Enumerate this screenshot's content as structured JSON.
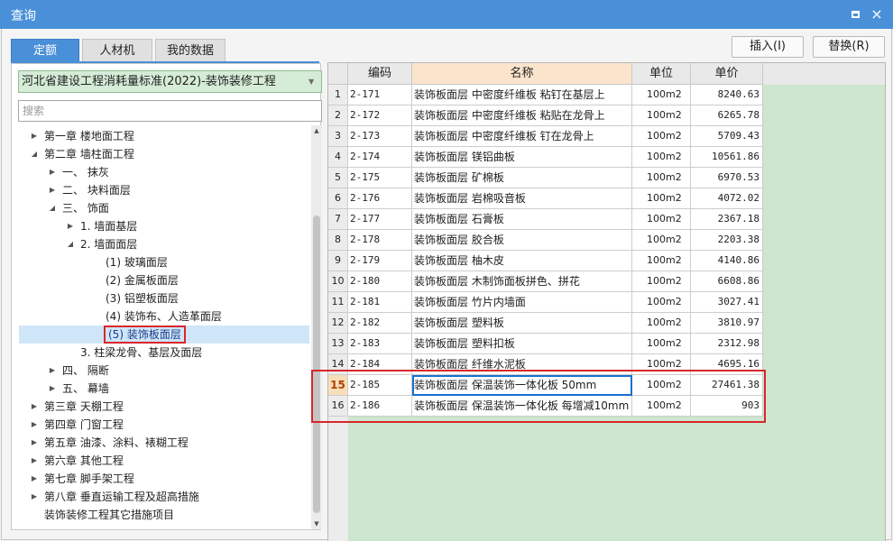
{
  "window": {
    "title": "查询",
    "maximize_icon": "maximize-icon",
    "close_icon": "close-icon",
    "close_glyph": "×"
  },
  "tabs": [
    {
      "label": "定额",
      "active": true
    },
    {
      "label": "人材机",
      "active": false
    },
    {
      "label": "我的数据",
      "active": false
    }
  ],
  "buttons": {
    "insert": "插入(I)",
    "replace": "替换(R)"
  },
  "standard_select": {
    "value": "河北省建设工程消耗量标准(2022)-装饰装修工程"
  },
  "search": {
    "placeholder": "搜索"
  },
  "tree": [
    {
      "label": "第一章 楼地面工程",
      "expanded": false,
      "has_children": true,
      "level": 0
    },
    {
      "label": "第二章 墙柱面工程",
      "expanded": true,
      "has_children": true,
      "level": 0
    },
    {
      "label": "一、 抹灰",
      "expanded": false,
      "has_children": true,
      "level": 1
    },
    {
      "label": "二、 块料面层",
      "expanded": false,
      "has_children": true,
      "level": 1
    },
    {
      "label": "三、 饰面",
      "expanded": true,
      "has_children": true,
      "level": 1
    },
    {
      "label": "1. 墙面基层",
      "expanded": false,
      "has_children": true,
      "level": 2
    },
    {
      "label": "2. 墙面面层",
      "expanded": true,
      "has_children": true,
      "level": 2
    },
    {
      "label": "(1) 玻璃面层",
      "has_children": false,
      "level": 3
    },
    {
      "label": "(2) 金属板面层",
      "has_children": false,
      "level": 3
    },
    {
      "label": "(3) 铝塑板面层",
      "has_children": false,
      "level": 3
    },
    {
      "label": "(4) 装饰布、人造革面层",
      "has_children": false,
      "level": 3
    },
    {
      "label": "(5) 装饰板面层",
      "has_children": false,
      "level": 3,
      "selected": true
    },
    {
      "label": "3. 柱梁龙骨、基层及面层",
      "has_children": false,
      "level": 2
    },
    {
      "label": "四、 隔断",
      "expanded": false,
      "has_children": true,
      "level": 1
    },
    {
      "label": "五、 幕墙",
      "expanded": false,
      "has_children": true,
      "level": 1
    },
    {
      "label": "第三章 天棚工程",
      "expanded": false,
      "has_children": true,
      "level": 0
    },
    {
      "label": "第四章 门窗工程",
      "expanded": false,
      "has_children": true,
      "level": 0
    },
    {
      "label": "第五章 油漆、涂料、裱糊工程",
      "expanded": false,
      "has_children": true,
      "level": 0
    },
    {
      "label": "第六章 其他工程",
      "expanded": false,
      "has_children": true,
      "level": 0
    },
    {
      "label": "第七章 脚手架工程",
      "expanded": false,
      "has_children": true,
      "level": 0
    },
    {
      "label": "第八章 垂直运输工程及超高措施",
      "expanded": false,
      "has_children": true,
      "level": 0
    },
    {
      "label": "装饰装修工程其它措施项目",
      "has_children": false,
      "level": 0
    }
  ],
  "table": {
    "columns": [
      "编码",
      "名称",
      "单位",
      "单价"
    ],
    "current_row": 15,
    "rows": [
      {
        "no": "1",
        "code": "2-171",
        "name": "装饰板面层 中密度纤维板 粘钉在基层上",
        "unit": "100m2",
        "price": "8240.63"
      },
      {
        "no": "2",
        "code": "2-172",
        "name": "装饰板面层 中密度纤维板 粘贴在龙骨上",
        "unit": "100m2",
        "price": "6265.78"
      },
      {
        "no": "3",
        "code": "2-173",
        "name": "装饰板面层 中密度纤维板 钉在龙骨上",
        "unit": "100m2",
        "price": "5709.43"
      },
      {
        "no": "4",
        "code": "2-174",
        "name": "装饰板面层 镁铝曲板",
        "unit": "100m2",
        "price": "10561.86"
      },
      {
        "no": "5",
        "code": "2-175",
        "name": "装饰板面层 矿棉板",
        "unit": "100m2",
        "price": "6970.53"
      },
      {
        "no": "6",
        "code": "2-176",
        "name": "装饰板面层 岩棉吸音板",
        "unit": "100m2",
        "price": "4072.02"
      },
      {
        "no": "7",
        "code": "2-177",
        "name": "装饰板面层 石膏板",
        "unit": "100m2",
        "price": "2367.18"
      },
      {
        "no": "8",
        "code": "2-178",
        "name": "装饰板面层 胶合板",
        "unit": "100m2",
        "price": "2203.38"
      },
      {
        "no": "9",
        "code": "2-179",
        "name": "装饰板面层 柚木皮",
        "unit": "100m2",
        "price": "4140.86"
      },
      {
        "no": "10",
        "code": "2-180",
        "name": "装饰板面层 木制饰面板拼色、拼花",
        "unit": "100m2",
        "price": "6608.86"
      },
      {
        "no": "11",
        "code": "2-181",
        "name": "装饰板面层 竹片内墙面",
        "unit": "100m2",
        "price": "3027.41"
      },
      {
        "no": "12",
        "code": "2-182",
        "name": "装饰板面层 塑料板",
        "unit": "100m2",
        "price": "3810.97"
      },
      {
        "no": "13",
        "code": "2-183",
        "name": "装饰板面层 塑料扣板",
        "unit": "100m2",
        "price": "2312.98"
      },
      {
        "no": "14",
        "code": "2-184",
        "name": "装饰板面层 纤维水泥板",
        "unit": "100m2",
        "price": "4695.16"
      },
      {
        "no": "15",
        "code": "2-185",
        "name": "装饰板面层 保温装饰一体化板 50mm",
        "unit": "100m2",
        "price": "27461.38"
      },
      {
        "no": "16",
        "code": "2-186",
        "name": "装饰板面层 保温装饰一体化板 每增减10mm",
        "unit": "100m2",
        "price": "903"
      }
    ]
  },
  "colors": {
    "accent": "#4a90d9",
    "grid_background": "#cde6cf",
    "highlight_red": "#d9262c",
    "name_header": "#fbe4cc"
  }
}
